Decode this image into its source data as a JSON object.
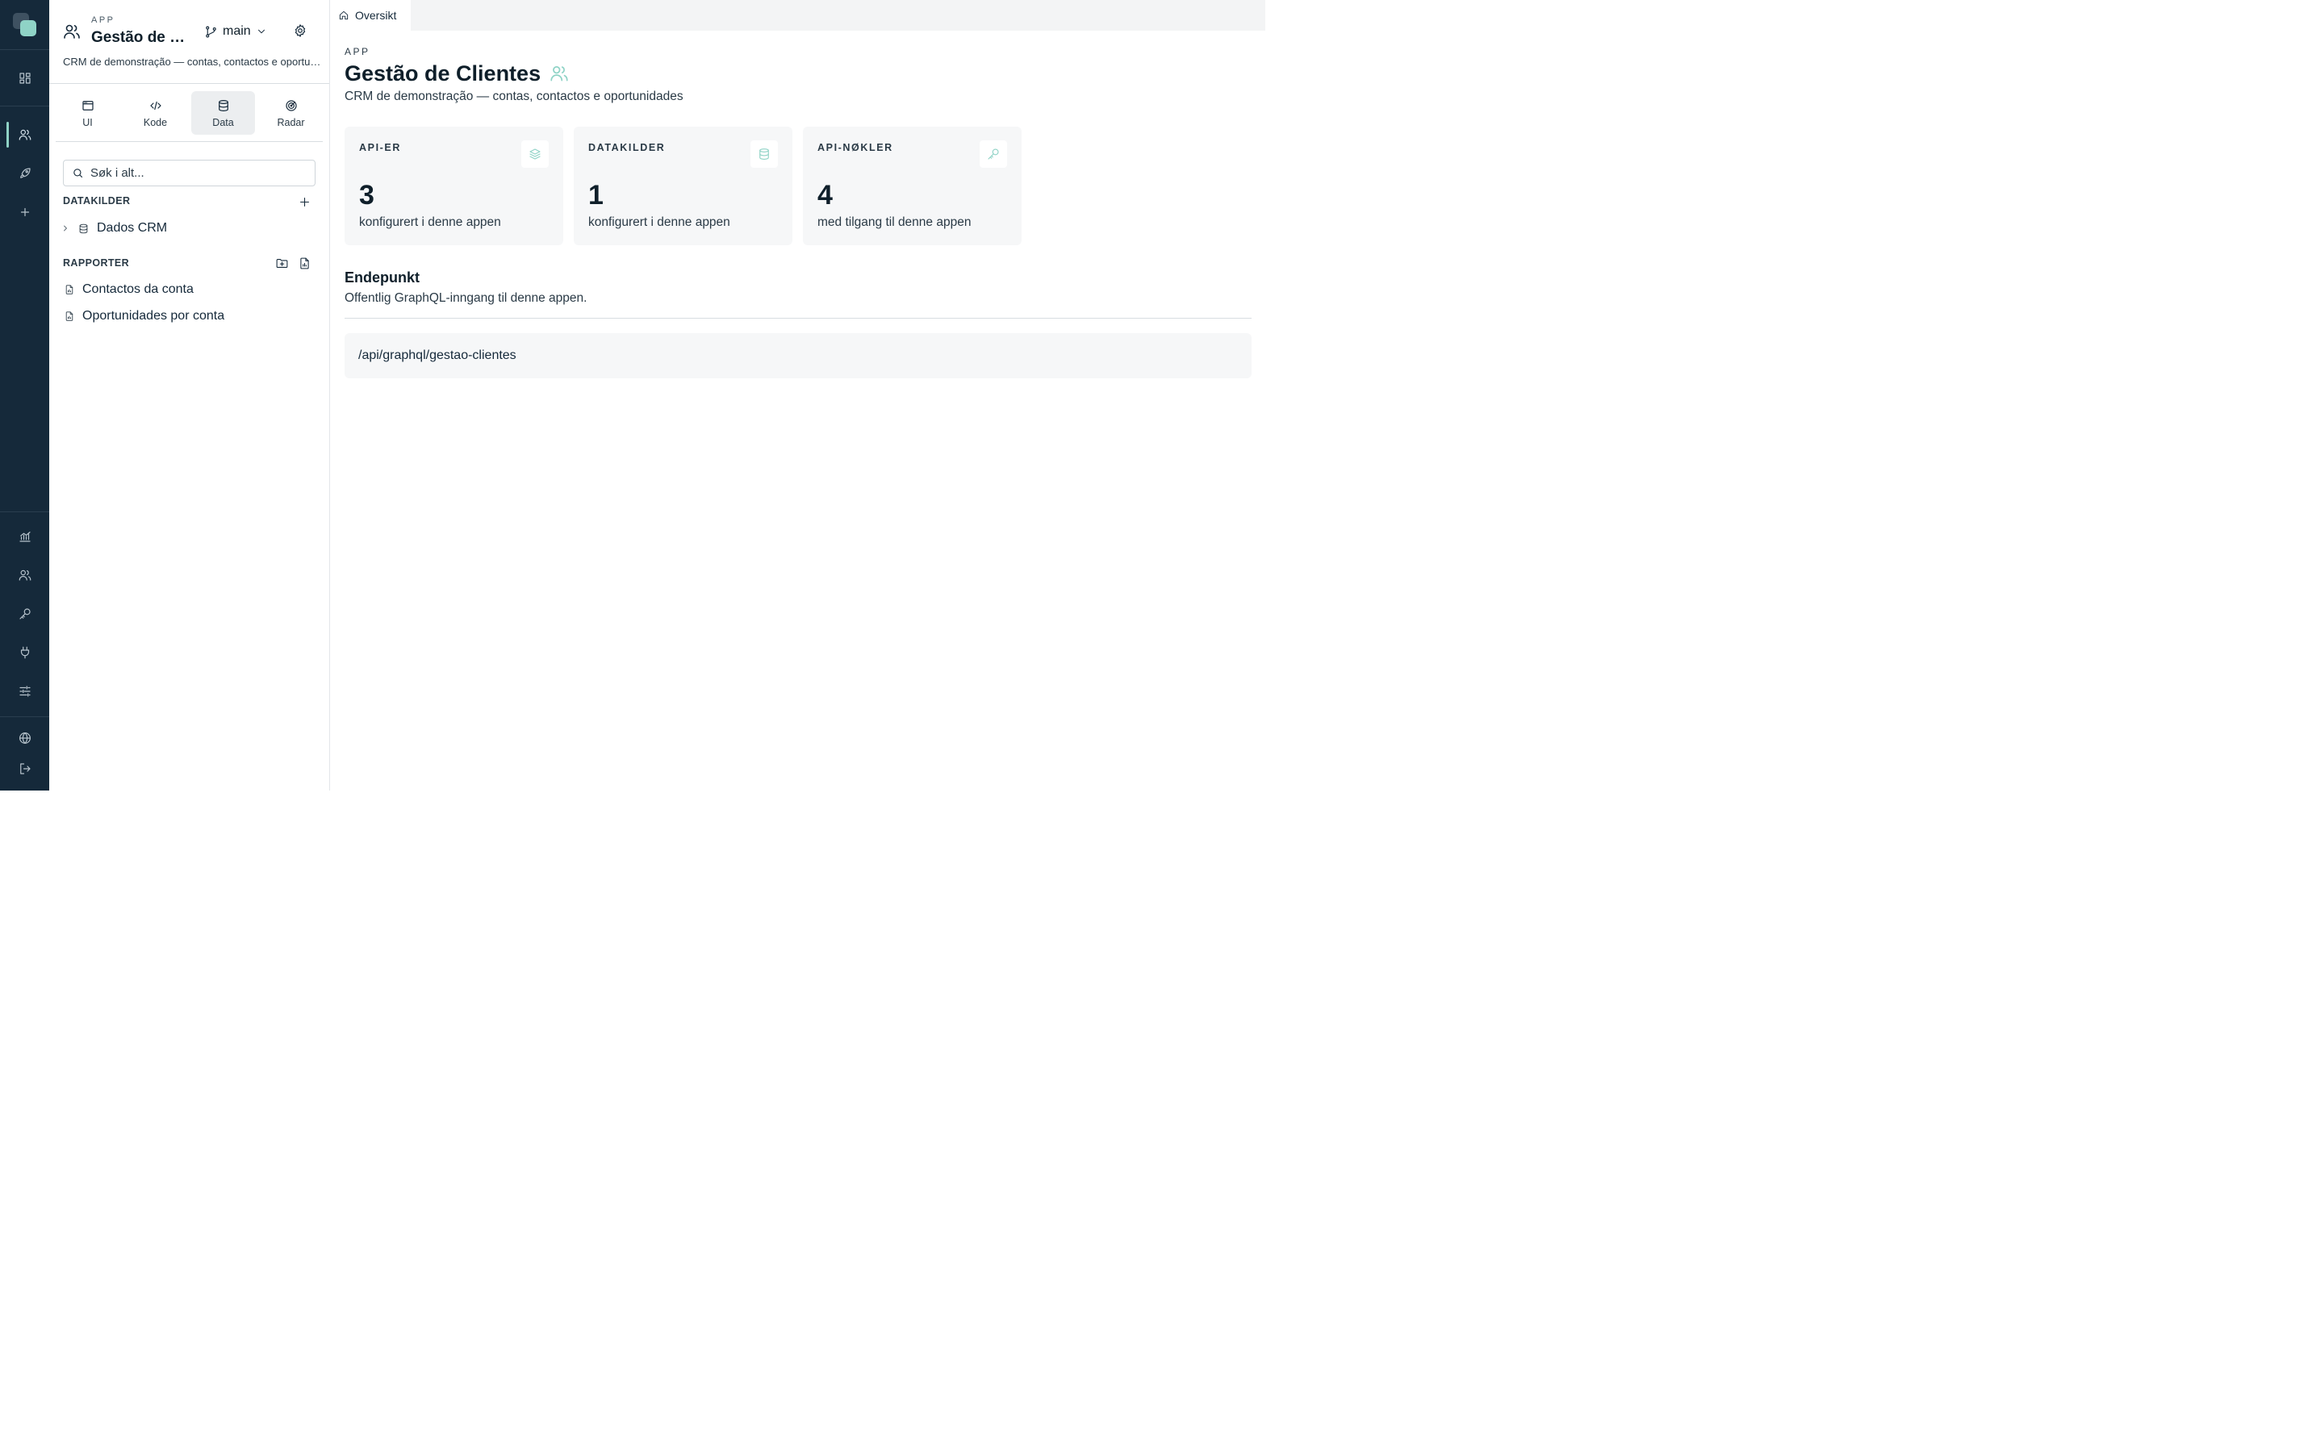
{
  "rail": {
    "top_items": [
      "dashboard-icon",
      "users-icon",
      "rocket-icon",
      "plus-icon"
    ],
    "bottom_items": [
      "analytics-icon",
      "team-icon",
      "key-icon",
      "plug-icon",
      "sliders-icon",
      "globe-icon",
      "logout-icon"
    ],
    "accent": "#8fd3c6",
    "background": "#15293a"
  },
  "sidebar": {
    "eyebrow": "APP",
    "app_title": "Gestão de Clientes",
    "branch": "main",
    "description": "CRM de demonstração — contas, contactos e oportunidades",
    "tabs": [
      {
        "label": "UI",
        "icon": "window-icon"
      },
      {
        "label": "Kode",
        "icon": "code-icon"
      },
      {
        "label": "Data",
        "icon": "database-icon",
        "active": true
      },
      {
        "label": "Radar",
        "icon": "radar-icon"
      }
    ],
    "search_placeholder": "Søk i alt...",
    "datasources_title": "DATAKILDER",
    "datasources": [
      "Dados CRM"
    ],
    "reports_title": "RAPPORTER",
    "reports": [
      "Contactos da conta",
      "Oportunidades por conta"
    ]
  },
  "tabbar": {
    "tab_label": "Oversikt"
  },
  "main": {
    "eyebrow": "APP",
    "title": "Gestão de Clientes",
    "subtitle": "CRM de demonstração — contas, contactos e oportunidades",
    "cards": [
      {
        "label": "API-ER",
        "value": "3",
        "caption": "konfigurert i denne appen",
        "icon": "layers-icon"
      },
      {
        "label": "DATAKILDER",
        "value": "1",
        "caption": "konfigurert i denne appen",
        "icon": "database-icon"
      },
      {
        "label": "API-NØKLER",
        "value": "4",
        "caption": "med tilgang til denne appen",
        "icon": "key-icon"
      }
    ],
    "endpoint_title": "Endepunkt",
    "endpoint_subtitle": "Offentlig GraphQL-inngang til denne appen.",
    "endpoint_url": "/api/graphql/gestao-clientes"
  }
}
